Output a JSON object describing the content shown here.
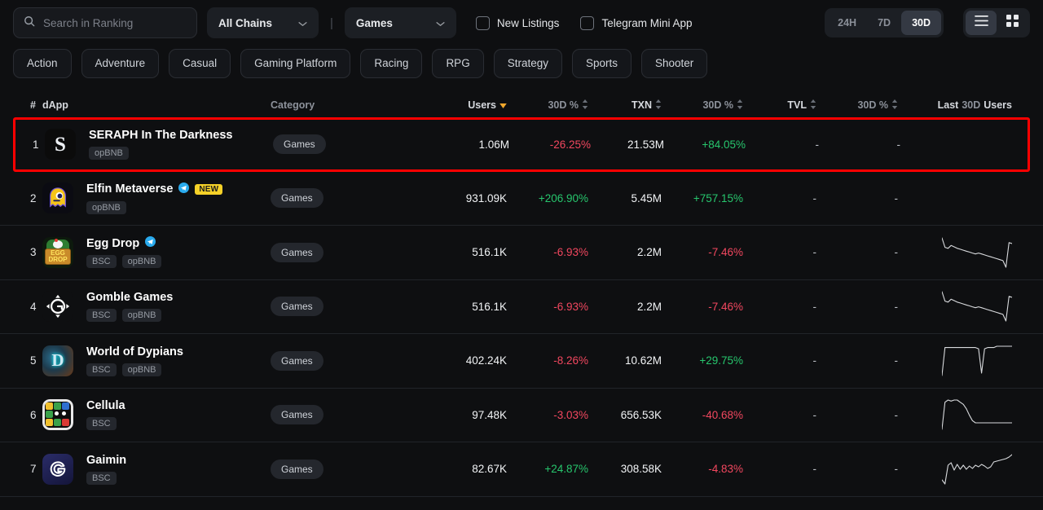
{
  "toolbar": {
    "search_placeholder": "Search in Ranking",
    "search_value": "",
    "search_icon": "search-icon",
    "chain_select": "All Chains",
    "category_select": "Games",
    "divider": "|",
    "new_listings_label": "New Listings",
    "telegram_label": "Telegram Mini App",
    "periods": [
      {
        "label": "24H",
        "active": false
      },
      {
        "label": "7D",
        "active": false
      },
      {
        "label": "30D",
        "active": true
      }
    ],
    "views": [
      {
        "icon": "list-view-icon",
        "active": true
      },
      {
        "icon": "grid-view-icon",
        "active": false
      }
    ]
  },
  "chips": [
    {
      "label": "Action"
    },
    {
      "label": "Adventure"
    },
    {
      "label": "Casual"
    },
    {
      "label": "Gaming Platform"
    },
    {
      "label": "Racing"
    },
    {
      "label": "RPG"
    },
    {
      "label": "Strategy"
    },
    {
      "label": "Sports"
    },
    {
      "label": "Shooter"
    }
  ],
  "table": {
    "headers": {
      "rank": "#",
      "dapp": "dApp",
      "category": "Category",
      "users": "Users",
      "users_change": "30D %",
      "txn": "TXN",
      "txn_change": "30D %",
      "tvl": "TVL",
      "tvl_change": "30D %",
      "sparkline_last": "Last",
      "sparkline_period": "30D",
      "sparkline_metric": "Users"
    },
    "rows": [
      {
        "rank": "1",
        "name": "SERAPH In The Darkness",
        "icon": "seraph-logo",
        "verified": false,
        "new_badge": null,
        "chains": [
          "opBNB"
        ],
        "category": "Games",
        "users": "1.06M",
        "users_change": "-26.25%",
        "users_change_dir": "neg",
        "txn": "21.53M",
        "txn_change": "+84.05%",
        "txn_change_dir": "pos",
        "tvl": "-",
        "tvl_change": "-",
        "sparkline": null,
        "highlighted": true
      },
      {
        "rank": "2",
        "name": "Elfin Metaverse",
        "icon": "elfin-logo",
        "verified": true,
        "new_badge": "NEW",
        "chains": [
          "opBNB"
        ],
        "category": "Games",
        "users": "931.09K",
        "users_change": "+206.90%",
        "users_change_dir": "pos",
        "txn": "5.45M",
        "txn_change": "+757.15%",
        "txn_change_dir": "pos",
        "tvl": "-",
        "tvl_change": "-",
        "sparkline": null,
        "highlighted": false
      },
      {
        "rank": "3",
        "name": "Egg Drop",
        "icon": "eggdrop-logo",
        "verified": true,
        "new_badge": null,
        "chains": [
          "BSC",
          "opBNB"
        ],
        "category": "Games",
        "users": "516.1K",
        "users_change": "-6.93%",
        "users_change_dir": "neg",
        "txn": "2.2M",
        "txn_change": "-7.46%",
        "txn_change_dir": "neg",
        "tvl": "-",
        "tvl_change": "-",
        "sparkline": [
          72,
          52,
          50,
          56,
          53,
          50,
          48,
          46,
          44,
          42,
          40,
          38,
          40,
          38,
          36,
          34,
          32,
          30,
          28,
          26,
          24,
          10,
          62,
          60
        ],
        "highlighted": false
      },
      {
        "rank": "4",
        "name": "Gomble Games",
        "icon": "gomble-logo",
        "verified": false,
        "new_badge": null,
        "chains": [
          "BSC",
          "opBNB"
        ],
        "category": "Games",
        "users": "516.1K",
        "users_change": "-6.93%",
        "users_change_dir": "neg",
        "txn": "2.2M",
        "txn_change": "-7.46%",
        "txn_change_dir": "neg",
        "tvl": "-",
        "tvl_change": "-",
        "sparkline": [
          72,
          52,
          50,
          56,
          53,
          50,
          48,
          46,
          44,
          42,
          40,
          38,
          40,
          38,
          36,
          34,
          32,
          30,
          28,
          26,
          24,
          10,
          62,
          60
        ],
        "highlighted": false
      },
      {
        "rank": "5",
        "name": "World of Dypians",
        "icon": "dypians-logo",
        "verified": false,
        "new_badge": null,
        "chains": [
          "BSC",
          "opBNB"
        ],
        "category": "Games",
        "users": "402.24K",
        "users_change": "-8.26%",
        "users_change_dir": "neg",
        "txn": "10.62M",
        "txn_change": "+29.75%",
        "txn_change_dir": "pos",
        "tvl": "-",
        "tvl_change": "-",
        "sparkline": [
          26,
          70,
          70,
          70,
          70,
          70,
          70,
          70,
          70,
          70,
          70,
          70,
          68,
          30,
          68,
          70,
          70,
          70,
          72,
          72,
          72,
          72,
          72,
          72
        ],
        "highlighted": false
      },
      {
        "rank": "6",
        "name": "Cellula",
        "icon": "cellula-logo",
        "verified": false,
        "new_badge": null,
        "chains": [
          "BSC"
        ],
        "category": "Games",
        "users": "97.48K",
        "users_change": "-3.03%",
        "users_change_dir": "neg",
        "txn": "656.53K",
        "txn_change": "-40.68%",
        "txn_change_dir": "neg",
        "tvl": "-",
        "tvl_change": "-",
        "sparkline": [
          22,
          72,
          76,
          74,
          76,
          76,
          72,
          68,
          60,
          48,
          38,
          34,
          34,
          34,
          34,
          34,
          34,
          34,
          34,
          34,
          34,
          34,
          34,
          34
        ],
        "highlighted": false
      },
      {
        "rank": "7",
        "name": "Gaimin",
        "icon": "gaimin-logo",
        "verified": false,
        "new_badge": null,
        "chains": [
          "BSC"
        ],
        "category": "Games",
        "users": "82.67K",
        "users_change": "+24.87%",
        "users_change_dir": "pos",
        "txn": "308.58K",
        "txn_change": "-4.83%",
        "txn_change_dir": "neg",
        "tvl": "-",
        "tvl_change": "-",
        "sparkline": [
          18,
          8,
          54,
          60,
          42,
          56,
          44,
          54,
          44,
          52,
          46,
          54,
          50,
          56,
          52,
          46,
          50,
          62,
          64,
          66,
          68,
          70,
          74,
          80
        ],
        "highlighted": false
      }
    ]
  },
  "colors": {
    "positive": "#27c66d",
    "negative": "#f2475f",
    "accent_sort": "#f0a72c",
    "highlight_border": "#ff0000",
    "background": "#0e0f11"
  }
}
